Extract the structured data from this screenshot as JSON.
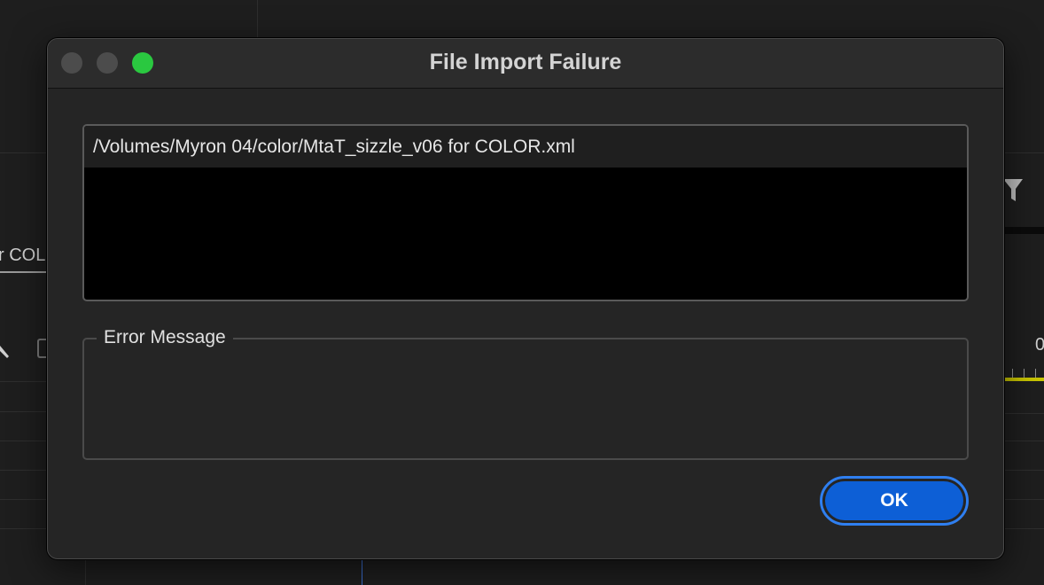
{
  "background": {
    "partial_tab_text": "r COL",
    "partial_number": "0"
  },
  "dialog": {
    "title": "File Import Failure",
    "files": [
      "/Volumes/Myron 04/color/MtaT_sizzle_v06 for COLOR.xml"
    ],
    "error_group_label": "Error Message",
    "error_message": "",
    "ok_label": "OK"
  },
  "colors": {
    "accent": "#0d5fd6",
    "focus_ring": "#2f7ff0",
    "zoom_button": "#2ac840"
  }
}
